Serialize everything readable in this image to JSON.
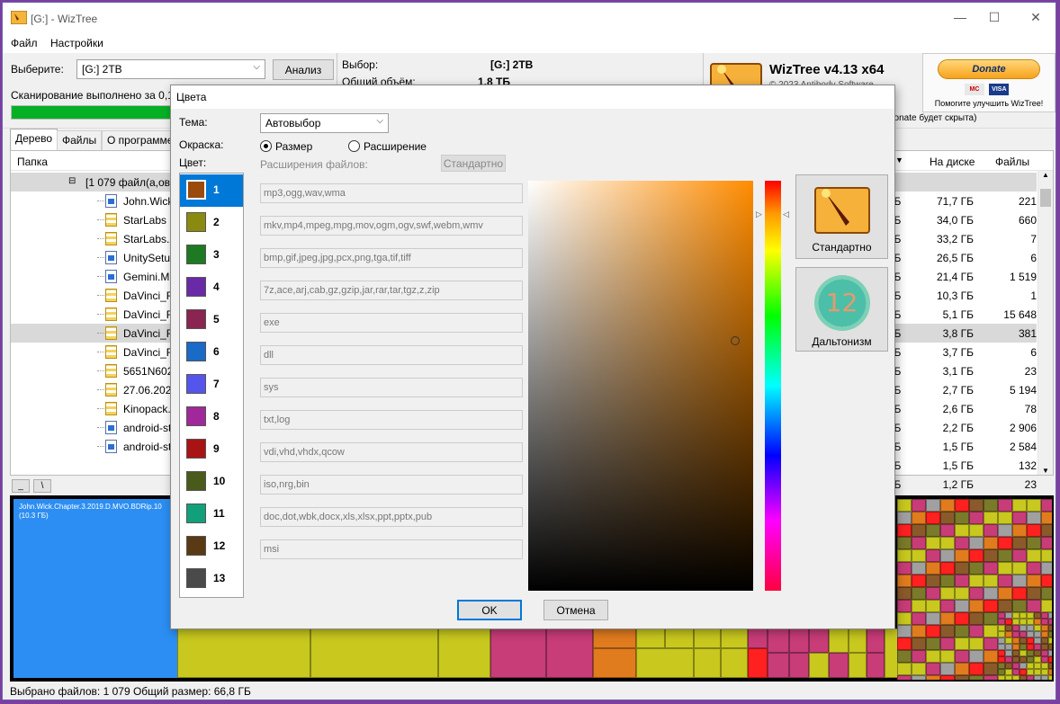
{
  "window": {
    "title": "[G:]  - WizTree",
    "controls": [
      "—",
      "☐",
      "✕"
    ]
  },
  "menu": [
    "Файл",
    "Настройки"
  ],
  "top": {
    "select_label": "Выберите:",
    "drive_value": "[G:] 2TB",
    "analyze_button": "Анализ",
    "scan_status": "Сканирование выполнено за 0,1",
    "selection_label": "Выбор:",
    "selection_value": "[G:]  2TB",
    "total_label": "Общий объём:",
    "total_value": "1,8 ТБ",
    "progress_percent": 100,
    "app_name": "WizTree v4.13 x64",
    "copyright_partial": "© 2023 Antibody Software",
    "donate_hint_partial": "donate будет скрыта)",
    "donate": {
      "button": "Donate",
      "cards": [
        "MC",
        "VISA"
      ],
      "caption": "Помогите улучшить WizTree!"
    }
  },
  "tabs": [
    "Дерево",
    "Файлы",
    "О программе"
  ],
  "tree": {
    "columns": {
      "folder": "Папка",
      "on_disk": "На диске",
      "files": "Файлы"
    },
    "root_label": "[1 079 файл(а,ов)]",
    "rows": [
      {
        "name": "John.Wick",
        "icon": "video-file-icon",
        "cut": "ГБ",
        "size": "71,7 ГБ",
        "files": "221"
      },
      {
        "name": "StarLabs (",
        "icon": "zip-file-icon",
        "cut": "ГБ",
        "size": "34,0 ГБ",
        "files": "660"
      },
      {
        "name": "StarLabs.z",
        "icon": "zip-file-icon",
        "cut": "ГБ",
        "size": "33,2 ГБ",
        "files": "7"
      },
      {
        "name": "UnitySetup",
        "icon": "exe-file-icon",
        "cut": "ГБ",
        "size": "26,5 ГБ",
        "files": "6"
      },
      {
        "name": "Gemini.M",
        "icon": "video-file-icon",
        "cut": "ГБ",
        "size": "21,4 ГБ",
        "files": "1 519"
      },
      {
        "name": "DaVinci_R",
        "icon": "zip-file-icon",
        "cut": "ГБ",
        "size": "10,3 ГБ",
        "files": "1"
      },
      {
        "name": "DaVinci_R",
        "icon": "zip-file-icon",
        "cut": "ГБ",
        "size": "5,1 ГБ",
        "files": "15 648"
      },
      {
        "name": "DaVinci_R",
        "icon": "zip-file-icon",
        "cut": "ГБ",
        "size": "3,8 ГБ",
        "files": "381",
        "selected": true
      },
      {
        "name": "DaVinci_R",
        "icon": "zip-file-icon",
        "cut": "ГБ",
        "size": "3,7 ГБ",
        "files": "6"
      },
      {
        "name": "5651N602",
        "icon": "zip-file-icon",
        "cut": "ГБ",
        "size": "3,1 ГБ",
        "files": "23"
      },
      {
        "name": "27.06.2020",
        "icon": "zip-file-icon",
        "cut": "ГБ",
        "size": "2,7 ГБ",
        "files": "5 194"
      },
      {
        "name": "Kinopack.",
        "icon": "zip-file-icon",
        "cut": "ГБ",
        "size": "2,6 ГБ",
        "files": "78"
      },
      {
        "name": "android-st",
        "icon": "exe-file-icon",
        "cut": "ГБ",
        "size": "2,2 ГБ",
        "files": "2 906"
      },
      {
        "name": "android-st",
        "icon": "exe-file-icon",
        "cut": "ГБ",
        "size": "1,5 ГБ",
        "files": "2 584"
      },
      {
        "name": "",
        "icon": "",
        "cut": "ГБ",
        "size": "1,5 ГБ",
        "files": "132"
      },
      {
        "name": "",
        "icon": "",
        "cut": "ГБ",
        "size": "1,2 ГБ",
        "files": "23"
      }
    ]
  },
  "mini_buttons": [
    "_",
    "\\"
  ],
  "treemap": {
    "label": "John.Wick.Chapter.3.2019.D.MVO.BDRip.10",
    "size": "(10.3 ГБ)"
  },
  "status": "Выбрано файлов: 1 079  Общий размер: 66,8 ГБ",
  "dialog": {
    "title": "Цвета",
    "theme_label": "Тема:",
    "theme_value": "Автовыбор",
    "coloring_label": "Окраска:",
    "radio_size": "Размер",
    "radio_ext": "Расширение",
    "color_label": "Цвет:",
    "ext_label": "Расширения файлов:",
    "standard_small": "Стандартно",
    "colors": [
      {
        "n": "1",
        "hex": "#9a4a0a"
      },
      {
        "n": "2",
        "hex": "#8a8a10"
      },
      {
        "n": "3",
        "hex": "#1e7a22"
      },
      {
        "n": "4",
        "hex": "#6a2aa8"
      },
      {
        "n": "5",
        "hex": "#8a2450"
      },
      {
        "n": "6",
        "hex": "#1a6ac8"
      },
      {
        "n": "7",
        "hex": "#5555ee"
      },
      {
        "n": "8",
        "hex": "#a0289a"
      },
      {
        "n": "9",
        "hex": "#a81414"
      },
      {
        "n": "10",
        "hex": "#4a5a1a"
      },
      {
        "n": "11",
        "hex": "#12a07a"
      },
      {
        "n": "12",
        "hex": "#5a3a14"
      },
      {
        "n": "13",
        "hex": "#4a4a4a"
      }
    ],
    "extensions": [
      "mp3,ogg,wav,wma",
      "mkv,mp4,mpeg,mpg,mov,ogm,ogv,swf,webm,wmv",
      "bmp,gif,jpeg,jpg,pcx,png,tga,tif,tiff",
      "7z,ace,arj,cab,gz,gzip,jar,rar,tar,tgz,z,zip",
      "exe",
      "dll",
      "sys",
      "txt,log",
      "vdi,vhd,vhdx,qcow",
      "iso,nrg,bin",
      "doc,dot,wbk,docx,xls,xlsx,ppt,pptx,pub",
      "msi"
    ],
    "standard_button": "Стандартно",
    "colorblind_button": "Дальтонизм",
    "colorblind_number": "12",
    "ok": "OK",
    "cancel": "Отмена"
  }
}
